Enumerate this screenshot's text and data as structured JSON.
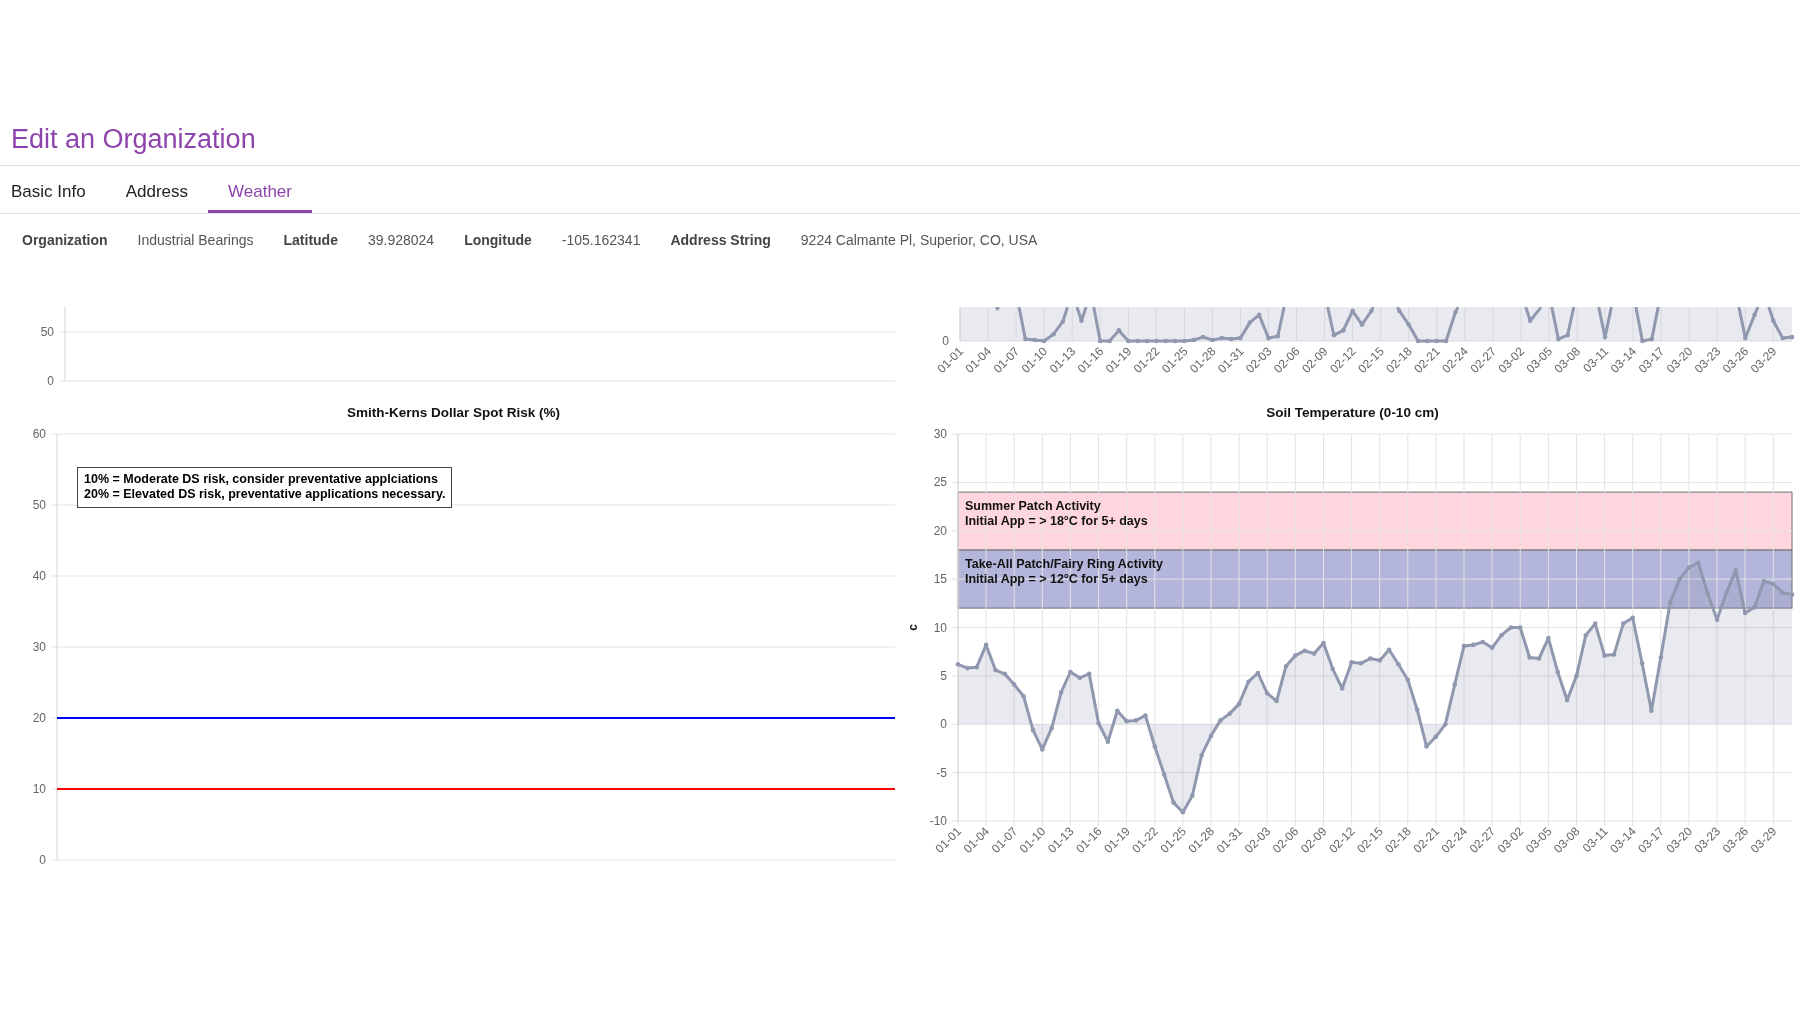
{
  "header": {
    "title": "Edit an Organization"
  },
  "tabs": [
    {
      "label": "Basic Info",
      "selected": false
    },
    {
      "label": "Address",
      "selected": false
    },
    {
      "label": "Weather",
      "selected": true
    }
  ],
  "details": [
    {
      "label": "Organization",
      "value": "Industrial Bearings"
    },
    {
      "label": "Latitude",
      "value": "39.928024"
    },
    {
      "label": "Longitude",
      "value": "-105.162341"
    },
    {
      "label": "Address String",
      "value": "9224 Calmante Pl, Superior, CO, USA"
    }
  ],
  "chart_grid": [
    {
      "kind": "strip",
      "y_labels": [
        "50",
        "0"
      ]
    },
    {
      "kind": "strip",
      "y_labels": [
        "0"
      ],
      "x_labels": [
        "01-01",
        "01-04",
        "01-07",
        "01-10",
        "01-13",
        "01-16",
        "01-19",
        "01-22",
        "01-25",
        "01-28",
        "01-31",
        "02-03",
        "02-06",
        "02-09",
        "02-12",
        "02-15",
        "02-18",
        "02-21",
        "02-24",
        "02-27",
        "03-02",
        "03-05",
        "03-08",
        "03-11",
        "03-14",
        "03-17",
        "03-20",
        "03-23",
        "03-26",
        "03-29"
      ]
    },
    {
      "kind": "full",
      "chart_data": {
        "type": "line",
        "title": "Smith-Kerns Dollar Spot Risk (%)",
        "categories": [
          null,
          null
        ],
        "ylim": [
          0,
          60
        ],
        "yticks": [
          0,
          10,
          20,
          30,
          40,
          50,
          60
        ],
        "grid": true,
        "ref_lines": [
          {
            "axis": "y",
            "value": 20,
            "color": "#0000ff"
          },
          {
            "axis": "y",
            "value": 10,
            "color": "#ff0000"
          }
        ],
        "annotations": [
          "10% = Moderate DS risk, consider preventative applciations",
          "20% = Elevated DS risk, preventative applications necessary."
        ]
      }
    },
    {
      "kind": "full",
      "chart_data": {
        "type": "area",
        "title": "Soil Temperature (0-10 cm)",
        "ylabel": "c",
        "categories": [
          "01-01",
          null,
          null,
          "01-04",
          null,
          null,
          "01-07",
          null,
          null,
          "01-10",
          null,
          null,
          "01-13",
          null,
          null,
          "01-16",
          null,
          null,
          "01-19",
          null,
          null,
          "01-22",
          null,
          null,
          "01-25",
          null,
          null,
          "01-28",
          null,
          null,
          "01-31",
          null,
          null,
          "02-03",
          null,
          null,
          "02-06",
          null,
          null,
          "02-09",
          null,
          null,
          "02-12",
          null,
          null,
          "02-15",
          null,
          null,
          "02-18",
          null,
          null,
          "02-21",
          null,
          null,
          "02-24",
          null,
          null,
          "02-27",
          null,
          null,
          "03-02",
          null,
          null,
          "03-05",
          null,
          null,
          "03-08",
          null,
          null,
          "03-11",
          null,
          null,
          "03-14",
          null,
          null,
          "03-17",
          null,
          null,
          "03-20",
          null,
          null,
          "03-23",
          null,
          null,
          "03-26",
          null,
          null,
          "03-29",
          null,
          null
        ],
        "ylim": [
          -10,
          30
        ],
        "yticks": [
          -10,
          -5,
          0,
          5,
          10,
          15,
          20,
          25,
          30
        ],
        "grid": true,
        "series": [
          {
            "color": "#8f98af",
            "values": [
              6.2,
              5.8,
              5.9,
              8.2,
              5.6,
              5.2,
              4.1,
              2.9,
              -0.6,
              -2.6,
              -0.4,
              3.3,
              5.4,
              4.8,
              5.2,
              0.1,
              -1.8,
              1.4,
              0.3,
              0.4,
              0.9,
              -2.3,
              -5.2,
              -8.1,
              -9.1,
              -7.4,
              -3.2,
              -1.2,
              0.4,
              1.1,
              2.1,
              4.4,
              5.3,
              3.2,
              2.4,
              6.0,
              7.1,
              7.6,
              7.3,
              8.4,
              5.7,
              3.7,
              6.4,
              6.3,
              6.8,
              6.6,
              7.7,
              6.2,
              4.6,
              1.5,
              -2.3,
              -1.3,
              0.0,
              4.1,
              8.1,
              8.2,
              8.5,
              7.9,
              9.2,
              10.0,
              10.0,
              6.9,
              6.8,
              8.9,
              5.4,
              2.5,
              5.0,
              9.2,
              10.4,
              7.1,
              7.2,
              10.4,
              11.0,
              6.3,
              1.4,
              6.9,
              12.6,
              15.0,
              16.2,
              16.7,
              13.5,
              10.8,
              13.6,
              15.9,
              11.5,
              12.1,
              14.8,
              14.5,
              13.6,
              13.4
            ]
          }
        ],
        "bands": [
          {
            "axis": "y",
            "from": 18,
            "to": 24,
            "color": "#ffd6de",
            "label": "Summer Patch Activity\nInitial App = > 18°C for 5+ days"
          },
          {
            "axis": "y",
            "from": 12,
            "to": 18,
            "color": "#b3b5da",
            "label": "Take-All Patch/Fairy Ring Activity\nInitial App = > 12°C for 5+ days"
          }
        ]
      }
    }
  ]
}
